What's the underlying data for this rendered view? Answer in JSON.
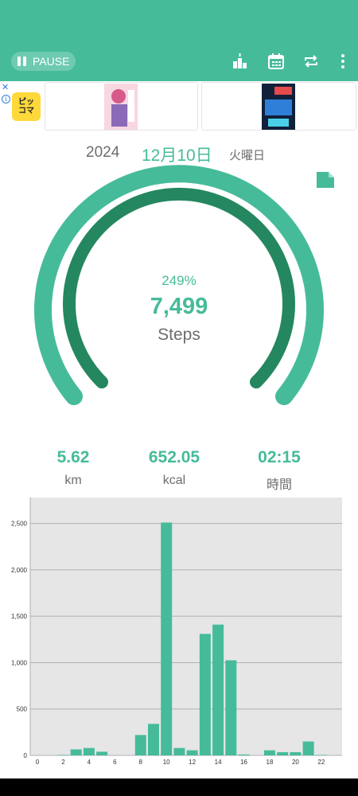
{
  "toolbar": {
    "pause_label": "PAUSE",
    "icons": [
      "ranking-icon",
      "calendar-icon",
      "repeat-icon",
      "more-vert-icon"
    ]
  },
  "ad": {
    "logo_line1": "ピッ",
    "logo_line2": "コマ",
    "close_label": "✕",
    "info_label": "i"
  },
  "date": {
    "year": "2024",
    "month_day": "12月10日",
    "weekday": "火曜日"
  },
  "gauge": {
    "percent": "249%",
    "steps": "7,499",
    "unit": "Steps",
    "fill_fraction": 1.0
  },
  "stats": [
    {
      "value": "5.62",
      "label": "km"
    },
    {
      "value": "652.05",
      "label": "kcal"
    },
    {
      "value": "02:15",
      "label": "時間"
    }
  ],
  "colors": {
    "primary": "#46bb9a",
    "dark": "#24875f",
    "text_gray": "#6d6d6d",
    "chart_bg": "#e6e6e6"
  },
  "chart_data": {
    "type": "bar",
    "categories": [
      0,
      1,
      2,
      3,
      4,
      5,
      6,
      7,
      8,
      9,
      10,
      11,
      12,
      13,
      14,
      15,
      16,
      17,
      18,
      19,
      20,
      21,
      22,
      23
    ],
    "values": [
      0,
      0,
      5,
      65,
      80,
      40,
      0,
      0,
      220,
      340,
      2510,
      80,
      55,
      1310,
      1410,
      1025,
      10,
      0,
      55,
      35,
      35,
      150,
      5,
      0
    ],
    "x_tick_labels": [
      "0",
      "2",
      "4",
      "6",
      "8",
      "10",
      "12",
      "14",
      "16",
      "18",
      "20",
      "22"
    ],
    "y_tick_labels": [
      "2,500",
      "2,000",
      "1,500",
      "1,000",
      "500",
      "0"
    ],
    "ylim": [
      0,
      2780
    ],
    "grid": true,
    "title": "",
    "xlabel": "",
    "ylabel": ""
  }
}
